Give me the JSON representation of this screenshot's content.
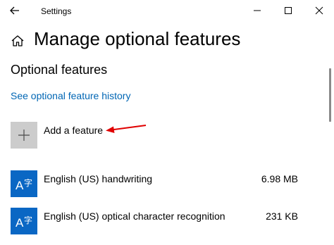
{
  "titlebar": {
    "title": "Settings",
    "back_icon": "back-arrow-icon",
    "minimize_icon": "minimize-icon",
    "maximize_icon": "maximize-icon",
    "close_icon": "close-icon"
  },
  "header": {
    "home_icon": "home-icon",
    "title": "Manage optional features"
  },
  "section": {
    "title": "Optional features",
    "history_link": "See optional feature history"
  },
  "add_feature": {
    "icon": "plus-icon",
    "label": "Add a feature",
    "annotation_icon": "red-arrow-icon",
    "annotation_color": "#e00000"
  },
  "features": [
    {
      "icon": "language-icon",
      "name": "English (US) handwriting",
      "size": "6.98 MB"
    },
    {
      "icon": "language-icon",
      "name": "English (US) optical character recognition",
      "size": "231 KB"
    }
  ],
  "colors": {
    "accent": "#0a67c4",
    "link": "#0066b4",
    "add_tile": "#cccccc",
    "background": "#ffffff"
  }
}
